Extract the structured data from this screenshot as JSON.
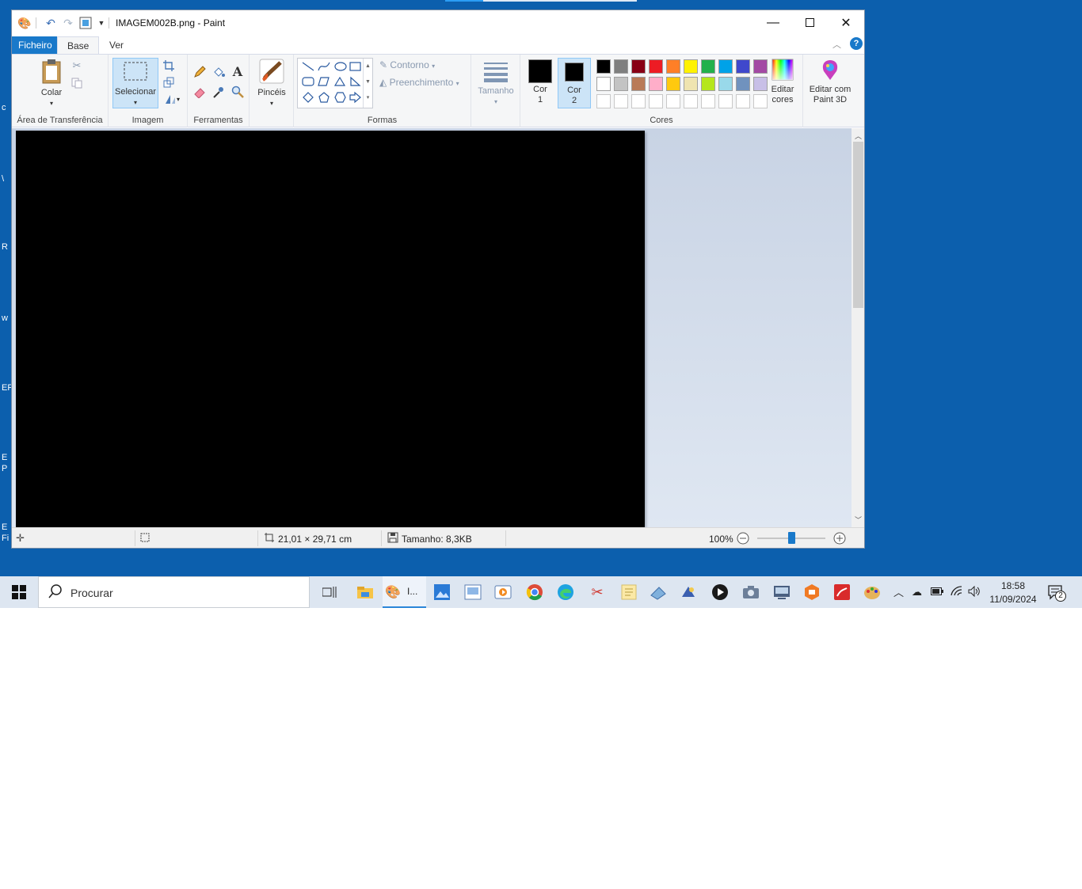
{
  "window": {
    "title": "IMAGEM002B.png - Paint"
  },
  "tabs": [
    {
      "label": "Ficheiro"
    },
    {
      "label": "Base"
    },
    {
      "label": "Ver"
    }
  ],
  "ribbon": {
    "clipboard": {
      "paste_label": "Colar",
      "group_label": "Área de Transferência"
    },
    "image": {
      "select_label": "Selecionar",
      "group_label": "Imagem"
    },
    "tools": {
      "group_label": "Ferramentas"
    },
    "brushes": {
      "label": "Pincéis"
    },
    "shapes": {
      "outline_label": "Contorno",
      "fill_label": "Preenchimento",
      "group_label": "Formas"
    },
    "size": {
      "label": "Tamanho"
    },
    "colors": {
      "color1_label_a": "Cor",
      "color1_label_b": "1",
      "color2_label_a": "Cor",
      "color2_label_b": "2",
      "edit_label_a": "Editar",
      "edit_label_b": "cores",
      "group_label": "Cores",
      "color1": "#000000",
      "color2": "#000000",
      "palette_row1": [
        "#000000",
        "#7f7f7f",
        "#880015",
        "#ed1c24",
        "#ff7f27",
        "#fff200",
        "#22b14c",
        "#00a2e8",
        "#3f48cc",
        "#a349a4"
      ],
      "palette_row2": [
        "#ffffff",
        "#c3c3c3",
        "#b97a57",
        "#ffaec9",
        "#ffc90e",
        "#efe4b0",
        "#b5e61d",
        "#99d9ea",
        "#7092be",
        "#c8bfe7"
      ],
      "palette_row3": [
        "#ffffff",
        "#ffffff",
        "#ffffff",
        "#ffffff",
        "#ffffff",
        "#ffffff",
        "#ffffff",
        "#ffffff",
        "#ffffff",
        "#ffffff"
      ]
    },
    "paint3d": {
      "label_a": "Editar com",
      "label_b": "Paint 3D"
    }
  },
  "statusbar": {
    "dimensions": "21,01 × 29,71 cm",
    "filesize": "Tamanho: 8,3KB",
    "zoom": "100%",
    "zoom_level": 0.5
  },
  "taskbar": {
    "search_placeholder": "Procurar",
    "paint_label": "I...",
    "time": "18:58",
    "date": "11/09/2024",
    "notifications": "2"
  }
}
